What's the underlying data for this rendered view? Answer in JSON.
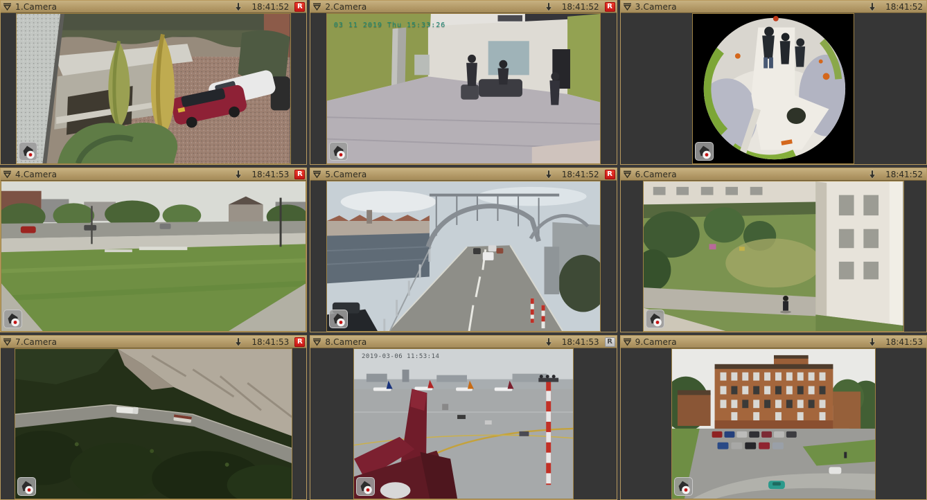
{
  "app": {
    "name": "Video surveillance monitor",
    "layout": "3x3 camera grid"
  },
  "colors": {
    "titlebar_bg": "#b49b69",
    "titlebar_text": "#2d2b22",
    "panel_background": "#3a3a3a",
    "cell_border_gold": "#b89a5e",
    "record_active_bg": "#d81717",
    "record_active_text": "#ffffff",
    "record_inactive_bg": "#c9c9c9",
    "record_inactive_text": "#4a4a4a",
    "osd_green": "#1d8a74"
  },
  "icons": {
    "collapse": "triangle-down-with-bar",
    "export": "arrow-down",
    "home_archive": "house-with-record-dot",
    "record_badge_letter": "R"
  },
  "cameras": [
    {
      "name": "1.Camera",
      "time": "18:41:52",
      "record_badge": "R",
      "record_state": "recording",
      "scene": "courtyard with parked cars and conifers"
    },
    {
      "name": "2.Camera",
      "time": "18:41:52",
      "record_badge": "R",
      "record_state": "recording",
      "osd": "03 11 2019 Thu 15:33:26",
      "scene": "office interior with green walls"
    },
    {
      "name": "3.Camera",
      "time": "18:41:52",
      "record_state": "none",
      "scene": "fisheye ceiling view of lobby"
    },
    {
      "name": "4.Camera",
      "time": "18:41:53",
      "record_badge": "R",
      "record_state": "recording",
      "scene": "park lawn and street with buildings"
    },
    {
      "name": "5.Camera",
      "time": "18:41:52",
      "record_badge": "R",
      "record_state": "recording",
      "scene": "steel arch bridge road over river"
    },
    {
      "name": "6.Camera",
      "time": "18:41:52",
      "record_state": "none",
      "scene": "white building courtyard with walking person"
    },
    {
      "name": "7.Camera",
      "time": "18:41:53",
      "record_badge": "R",
      "record_state": "recording",
      "scene": "aerial cliff road with trucks and forest"
    },
    {
      "name": "8.Camera",
      "time": "18:41:53",
      "record_badge": "R",
      "record_state": "idle",
      "osd": "2019-03-06 11:53:14",
      "scene": "airport apron with aircraft tail"
    },
    {
      "name": "9.Camera",
      "time": "18:41:53",
      "record_state": "none",
      "scene": "brick building with parking lot"
    }
  ]
}
